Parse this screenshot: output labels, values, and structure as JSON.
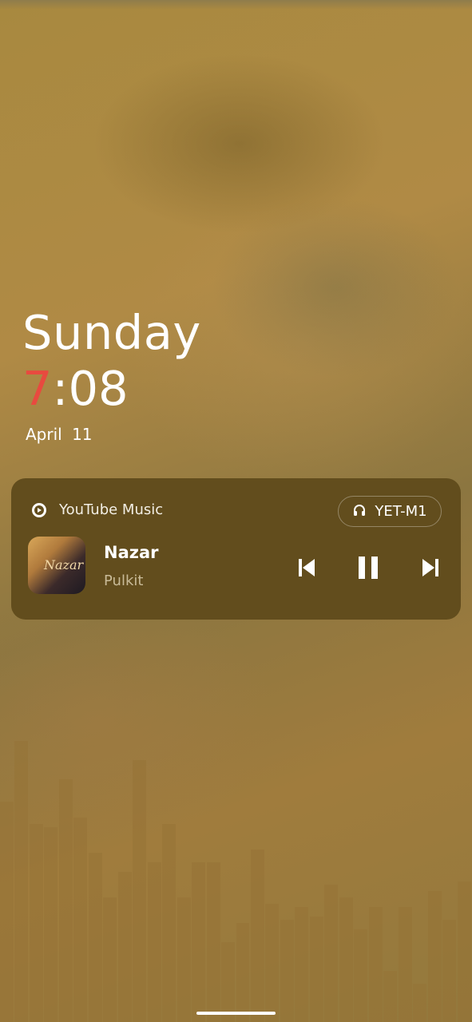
{
  "lockscreen": {
    "day": "Sunday",
    "time": {
      "hour": "7",
      "separator": ":",
      "minutes": "08"
    },
    "date": "April 11"
  },
  "media_card": {
    "app_name": "YouTube Music",
    "app_icon": "youtube-music-icon",
    "output_device": {
      "icon": "headphones-icon",
      "label": "YET-M1"
    },
    "track": {
      "title": "Nazar",
      "artist": "Pulkit",
      "artwork_text": "Nazar"
    },
    "controls": {
      "previous": "skip-previous-icon",
      "play_pause": "pause-icon",
      "next": "skip-next-icon"
    }
  },
  "colors": {
    "hour_accent": "#e84a3f",
    "card_background": "#624d1d"
  },
  "visualizer": {
    "levels": [
      0.69,
      0.88,
      0.62,
      0.61,
      0.76,
      0.64,
      0.53,
      0.39,
      0.47,
      0.82,
      0.5,
      0.62,
      0.39,
      0.5,
      0.5,
      0.25,
      0.31,
      0.54,
      0.37,
      0.32,
      0.36,
      0.33,
      0.43,
      0.39,
      0.29,
      0.36,
      0.16,
      0.36,
      0.12,
      0.41,
      0.32,
      0.44
    ]
  },
  "navigation": {
    "handle": "home-indicator"
  }
}
